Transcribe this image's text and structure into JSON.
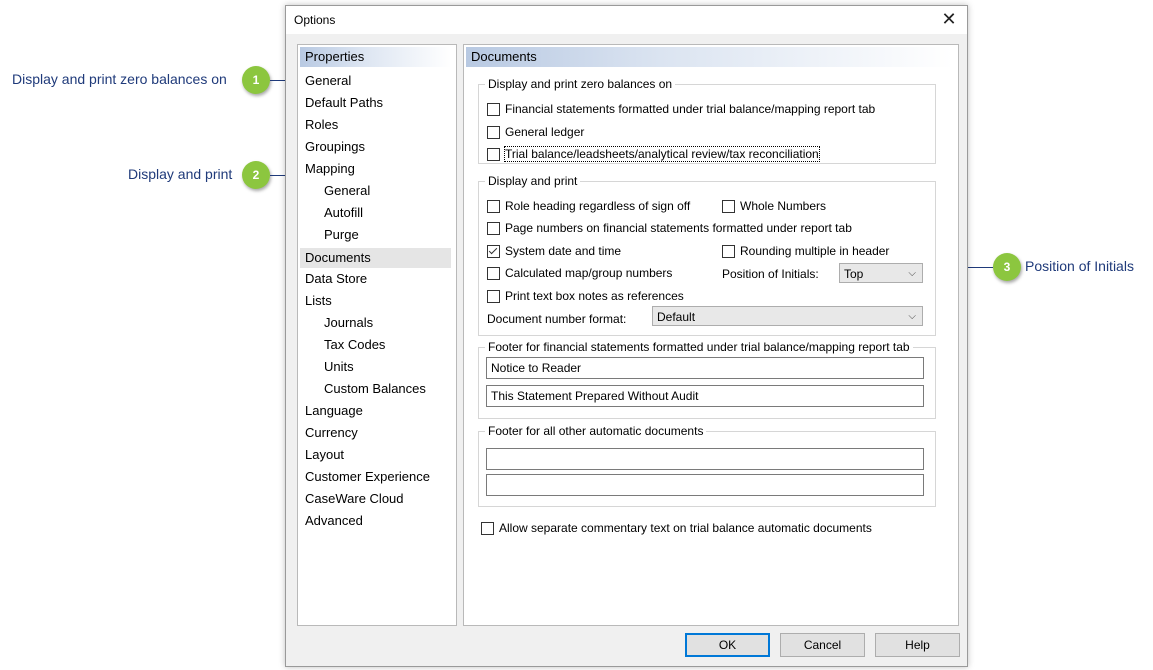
{
  "callouts": [
    {
      "num": "1",
      "text": "Display and print zero balances on"
    },
    {
      "num": "2",
      "text": "Display and print"
    },
    {
      "num": "3",
      "text": "Position of Initials"
    }
  ],
  "dialog": {
    "title": "Options",
    "close_glyph": "✕"
  },
  "properties": {
    "header": "Properties",
    "items": [
      {
        "label": "General"
      },
      {
        "label": "Default Paths"
      },
      {
        "label": "Roles"
      },
      {
        "label": "Groupings"
      },
      {
        "label": "Mapping"
      },
      {
        "label": "General"
      },
      {
        "label": "Autofill"
      },
      {
        "label": "Purge"
      },
      {
        "label": "Documents"
      },
      {
        "label": "Data Store"
      },
      {
        "label": "Lists"
      },
      {
        "label": "Journals"
      },
      {
        "label": "Tax Codes"
      },
      {
        "label": "Units"
      },
      {
        "label": "Custom Balances"
      },
      {
        "label": "Language"
      },
      {
        "label": "Currency"
      },
      {
        "label": "Layout"
      },
      {
        "label": "Customer Experience"
      },
      {
        "label": "CaseWare Cloud"
      },
      {
        "label": "Advanced"
      }
    ]
  },
  "documents": {
    "header": "Documents",
    "zero_group": {
      "legend": "Display and print zero balances on",
      "options": [
        {
          "label": "Financial statements formatted under trial balance/mapping report tab",
          "checked": false
        },
        {
          "label": "General ledger",
          "checked": false
        },
        {
          "label": "Trial balance/leadsheets/analytical review/tax reconciliation",
          "checked": false
        }
      ]
    },
    "print_group": {
      "legend": "Display and print",
      "role_heading": {
        "label": "Role heading regardless of sign off",
        "checked": false
      },
      "whole_numbers": {
        "label": "Whole Numbers",
        "checked": false
      },
      "page_numbers": {
        "label": "Page numbers on financial statements formatted under report tab",
        "checked": false
      },
      "system_date": {
        "label": "System date and time",
        "checked": true
      },
      "rounding": {
        "label": "Rounding multiple in header",
        "checked": false
      },
      "calculated": {
        "label": "Calculated map/group numbers",
        "checked": false
      },
      "position_label": "Position of Initials:",
      "position_value": "Top",
      "text_box": {
        "label": "Print text box notes as references",
        "checked": false
      },
      "doc_number_label": "Document number format:",
      "doc_number_value": "Default"
    },
    "footer_fs": {
      "legend": "Footer for financial statements formatted under trial balance/mapping report tab",
      "line1": "Notice to Reader",
      "line2": "This Statement Prepared Without Audit"
    },
    "footer_other": {
      "legend": "Footer for all other automatic documents",
      "line1": "",
      "line2": ""
    },
    "allow_separate": {
      "label": "Allow separate commentary text on trial balance automatic documents",
      "checked": false
    }
  },
  "buttons": {
    "ok": "OK",
    "cancel": "Cancel",
    "help": "Help"
  },
  "colors": {
    "callout_green": "#8cc63f",
    "callout_text": "#1f3a7a",
    "default_button_border": "#0078d7"
  }
}
